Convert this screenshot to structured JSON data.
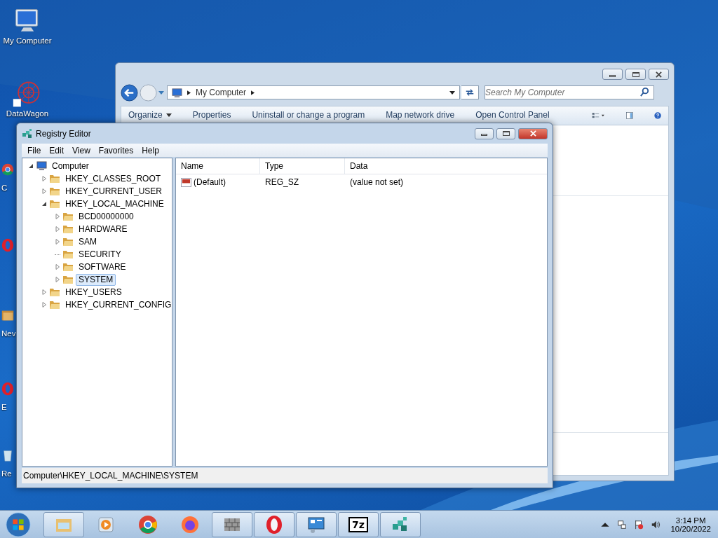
{
  "desktop": {
    "icons": [
      {
        "kind": "computer",
        "label": "My Computer"
      },
      {
        "kind": "app",
        "label": "DataWagon"
      },
      {
        "kind": "chrome",
        "label": "C"
      },
      {
        "kind": "opera"
      },
      {
        "kind": "folder",
        "label": "Nev"
      },
      {
        "kind": "opera",
        "label": "E"
      },
      {
        "kind": "bin",
        "label": "Re"
      }
    ]
  },
  "explorer": {
    "address": "My Computer",
    "search": {
      "placeholder": "Search My Computer"
    },
    "commands": [
      {
        "label": "Organize",
        "dropdown": true
      },
      {
        "label": "Properties",
        "dropdown": false
      },
      {
        "label": "Uninstall or change a program",
        "dropdown": false
      },
      {
        "label": "Map network drive",
        "dropdown": false
      },
      {
        "label": "Open Control Panel",
        "dropdown": false
      }
    ]
  },
  "registry": {
    "title": "Registry Editor",
    "menu": [
      "File",
      "Edit",
      "View",
      "Favorites",
      "Help"
    ],
    "tree": [
      {
        "label": "Computer",
        "kind": "computer",
        "expanded": true,
        "expandable": true,
        "selected": false,
        "children": [
          {
            "label": "HKEY_CLASSES_ROOT",
            "kind": "folder",
            "expanded": false,
            "expandable": true,
            "selected": false
          },
          {
            "label": "HKEY_CURRENT_USER",
            "kind": "folder",
            "expanded": false,
            "expandable": true,
            "selected": false
          },
          {
            "label": "HKEY_LOCAL_MACHINE",
            "kind": "folder",
            "expanded": true,
            "expandable": true,
            "selected": false,
            "children": [
              {
                "label": "BCD00000000",
                "kind": "folder",
                "expanded": false,
                "expandable": true,
                "selected": false
              },
              {
                "label": "HARDWARE",
                "kind": "folder",
                "expanded": false,
                "expandable": true,
                "selected": false
              },
              {
                "label": "SAM",
                "kind": "folder",
                "expanded": false,
                "expandable": true,
                "selected": false
              },
              {
                "label": "SECURITY",
                "kind": "folder",
                "expanded": false,
                "expandable": false,
                "selected": false
              },
              {
                "label": "SOFTWARE",
                "kind": "folder",
                "expanded": false,
                "expandable": true,
                "selected": false
              },
              {
                "label": "SYSTEM",
                "kind": "folder",
                "expanded": false,
                "expandable": true,
                "selected": true
              }
            ]
          },
          {
            "label": "HKEY_USERS",
            "kind": "folder",
            "expanded": false,
            "expandable": true,
            "selected": false
          },
          {
            "label": "HKEY_CURRENT_CONFIG",
            "kind": "folder",
            "expanded": false,
            "expandable": true,
            "selected": false
          }
        ]
      }
    ],
    "columns": [
      "Name",
      "Type",
      "Data"
    ],
    "rows": [
      {
        "name": "(Default)",
        "type": "REG_SZ",
        "data": "(value not set)"
      }
    ],
    "status": "Computer\\HKEY_LOCAL_MACHINE\\SYSTEM"
  },
  "taskbar": {
    "items": [
      {
        "kind": "explorer"
      },
      {
        "kind": "media"
      },
      {
        "kind": "chrome"
      },
      {
        "kind": "firefox"
      },
      {
        "kind": "wall"
      },
      {
        "kind": "opera"
      },
      {
        "kind": "panel"
      },
      {
        "kind": "sevenzip",
        "label": "7z"
      },
      {
        "kind": "regedit"
      }
    ],
    "clock": {
      "time": "3:14 PM",
      "date": "10/20/2022"
    }
  }
}
